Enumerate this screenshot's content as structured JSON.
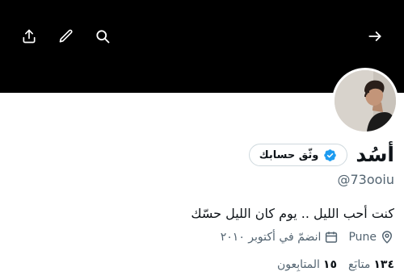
{
  "header": {
    "icons": [
      "share-icon",
      "edit-pencil-icon",
      "search-icon",
      "forward-arrow-icon"
    ]
  },
  "profile": {
    "display_name": "أسُد",
    "verify_button_label": "وثّق حسابك",
    "handle": "@73ooiu",
    "bio": "كنت أحب الليل .. يوم كان الليل حسّك",
    "location": "Pune",
    "joined": "انضمّ في أكتوبر ٢٠١٠",
    "following_count": "١٣٤",
    "following_label": "متابَع",
    "followers_count": "١٥",
    "followers_label": "المتابِعون"
  },
  "colors": {
    "banner": "#000000",
    "verified_badge": "#1d9bf0",
    "secondary_text": "#536471"
  }
}
